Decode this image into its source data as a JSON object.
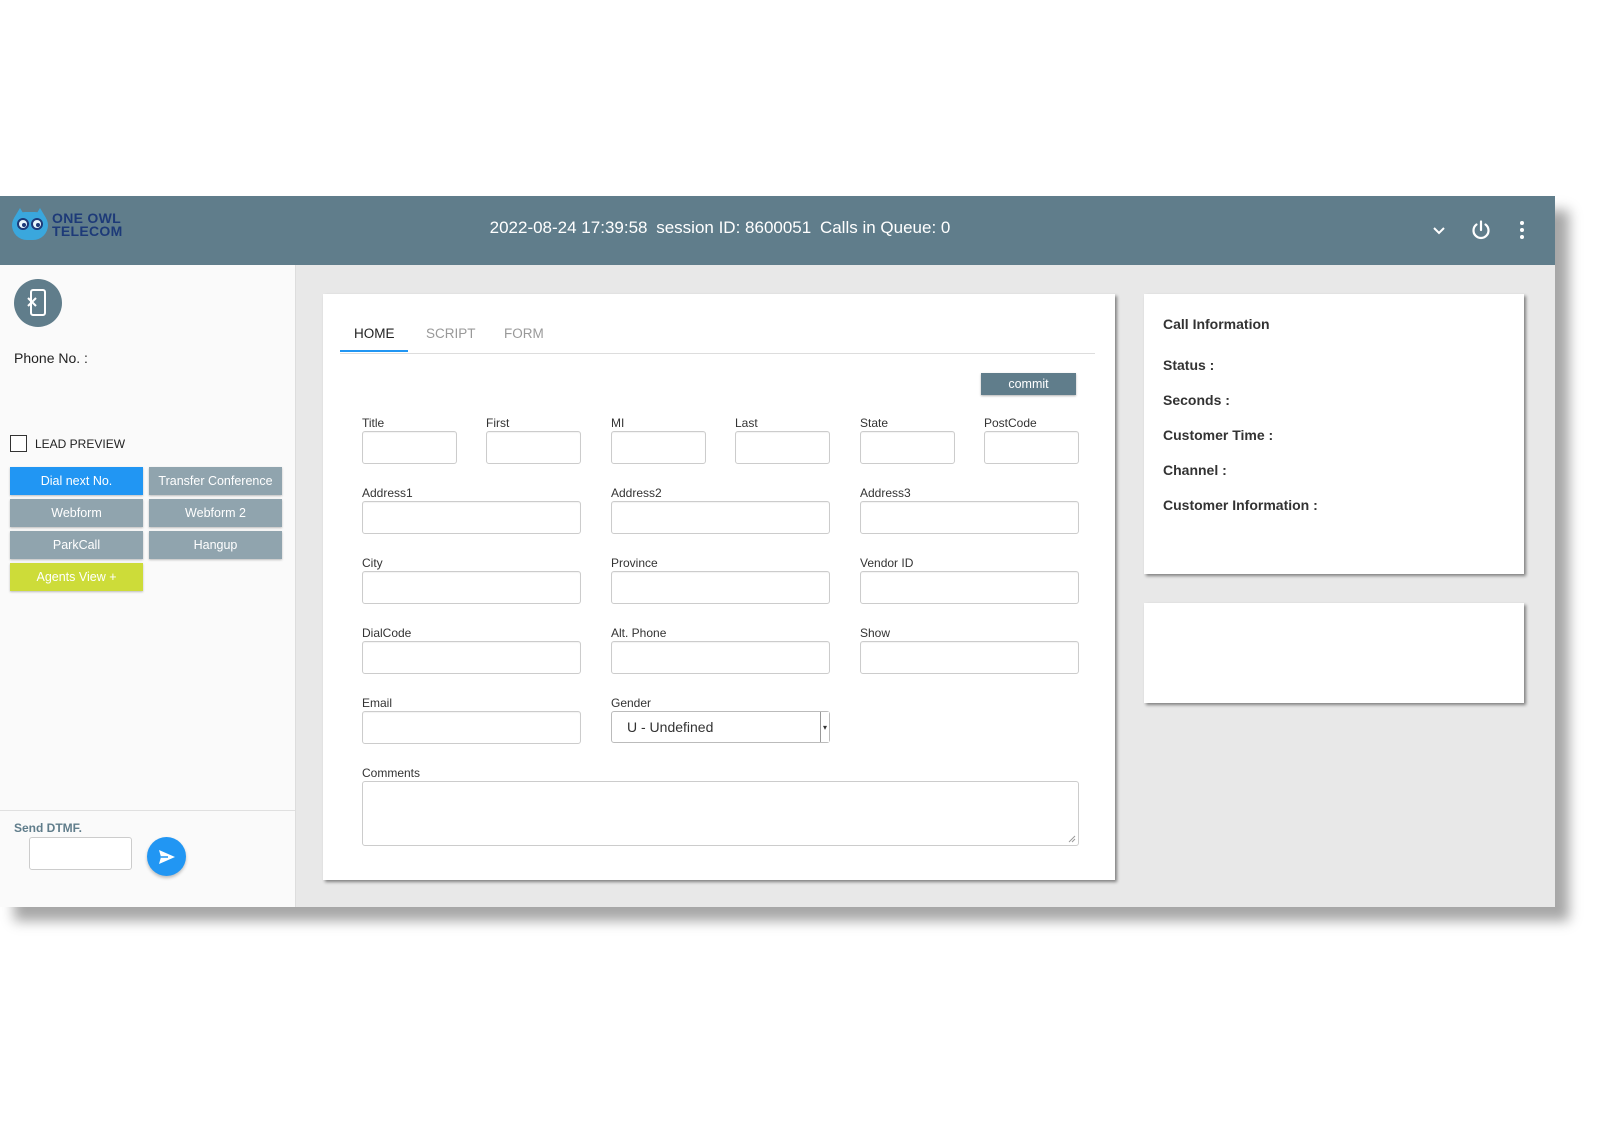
{
  "header": {
    "logo_line1": "ONE OWL",
    "logo_line2": "TELECOM",
    "datetime": "2022-08-24 17:39:58",
    "session_label": "session ID: 8600051",
    "queue_label": "Calls in Queue: 0",
    "icons": [
      "chevron-down-icon",
      "power-icon",
      "more-vert-icon"
    ]
  },
  "sidebar": {
    "phone_label": "Phone No. :",
    "lead_preview": "LEAD PREVIEW",
    "buttons": {
      "dial_next": "Dial next No.",
      "transfer_conference": "Transfer Conference",
      "webform": "Webform",
      "webform2": "Webform 2",
      "parkcall": "ParkCall",
      "hangup": "Hangup",
      "agents_view": "Agents View +"
    },
    "dtmf_label": "Send DTMF.",
    "dtmf_value": ""
  },
  "tabs": [
    "HOME",
    "SCRIPT",
    "FORM"
  ],
  "form": {
    "commit": "commit",
    "labels": {
      "title": "Title",
      "first": "First",
      "mi": "MI",
      "last": "Last",
      "state": "State",
      "postcode": "PostCode",
      "address1": "Address1",
      "address2": "Address2",
      "address3": "Address3",
      "city": "City",
      "province": "Province",
      "vendor_id": "Vendor ID",
      "dialcode": "DialCode",
      "alt_phone": "Alt. Phone",
      "show": "Show",
      "email": "Email",
      "gender": "Gender",
      "comments": "Comments"
    },
    "gender_value": "U - Undefined"
  },
  "call_info": {
    "title": "Call Information",
    "status": "Status :",
    "seconds": "Seconds :",
    "customer_time": "Customer Time :",
    "channel": "Channel :",
    "customer_information": "Customer Information :"
  },
  "colors": {
    "header": "#607d8b",
    "primary": "#2196f3",
    "secondary": "#90a4ae",
    "accent": "#cddc39"
  }
}
